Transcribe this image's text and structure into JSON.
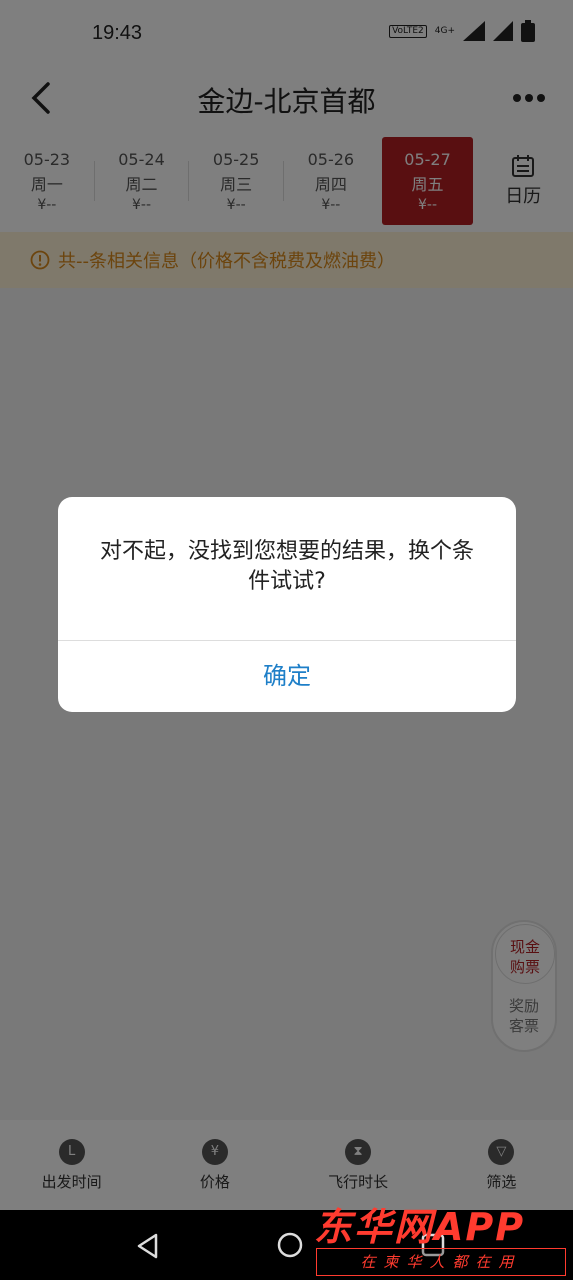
{
  "status": {
    "time": "19:43",
    "volte": "VoLTE2",
    "network": "4G+"
  },
  "nav": {
    "title": "金边-北京首都"
  },
  "dates": [
    {
      "date": "05-23",
      "weekday": "周一",
      "price": "¥--"
    },
    {
      "date": "05-24",
      "weekday": "周二",
      "price": "¥--"
    },
    {
      "date": "05-25",
      "weekday": "周三",
      "price": "¥--"
    },
    {
      "date": "05-26",
      "weekday": "周四",
      "price": "¥--"
    },
    {
      "date": "05-27",
      "weekday": "周五",
      "price": "¥--"
    }
  ],
  "calendar_label": "日历",
  "notice": "共--条相关信息（价格不含税费及燃油费）",
  "float": {
    "top": "现金\n购票",
    "top_line1": "现金",
    "top_line2": "购票",
    "bottom_line1": "奖励",
    "bottom_line2": "客票"
  },
  "tabs": [
    {
      "label": "出发时间",
      "icon": "L"
    },
    {
      "label": "价格",
      "icon": "¥"
    },
    {
      "label": "飞行时长",
      "icon": "⧗"
    },
    {
      "label": "筛选",
      "icon": "▽"
    }
  ],
  "dialog": {
    "message": "对不起，没找到您想要的结果，换个条件试试?",
    "confirm": "确定"
  },
  "watermark": {
    "main": "东华网APP",
    "sub": "在柬华人都在用"
  },
  "colors": {
    "accent": "#b21e23",
    "link": "#1e7fc8",
    "notice_text": "#d8891a"
  }
}
